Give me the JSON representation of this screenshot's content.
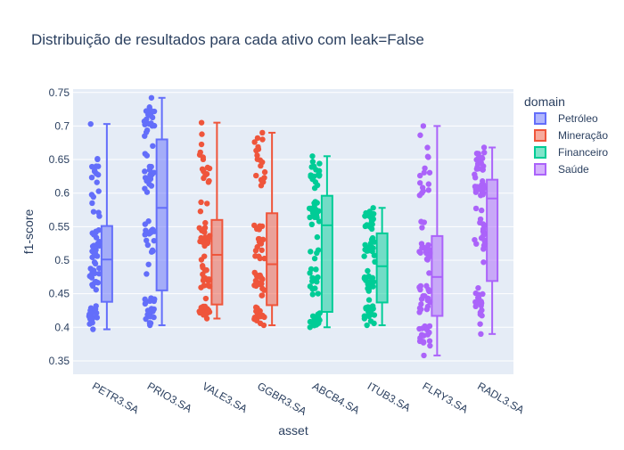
{
  "chart_data": {
    "type": "box",
    "title": "Distribuição de resultados para cada ativo com leak=False",
    "xlabel": "asset",
    "ylabel": "f1-score",
    "ylim": [
      0.33,
      0.755
    ],
    "yticks": [
      "0.35",
      "0.4",
      "0.45",
      "0.5",
      "0.55",
      "0.6",
      "0.65",
      "0.7",
      "0.75"
    ],
    "ytick_values": [
      0.35,
      0.4,
      0.45,
      0.5,
      0.55,
      0.6,
      0.65,
      0.7,
      0.75
    ],
    "categories": [
      "PETR3.SA",
      "PRIO3.SA",
      "VALE3.SA",
      "GGBR3.SA",
      "ABCB4.SA",
      "ITUB3.SA",
      "FLRY3.SA",
      "RADL3.SA"
    ],
    "legend_title": "domain",
    "legend_position": "top-right",
    "grid": true,
    "show_points": true,
    "series": [
      {
        "name": "Petróleo",
        "color": "#636efa",
        "boxes": [
          {
            "category": "PETR3.SA",
            "min": 0.397,
            "q1": 0.438,
            "median": 0.501,
            "q3": 0.551,
            "max": 0.703
          },
          {
            "category": "PRIO3.SA",
            "min": 0.403,
            "q1": 0.455,
            "median": 0.578,
            "q3": 0.68,
            "max": 0.742
          }
        ]
      },
      {
        "name": "Mineração",
        "color": "#ef553b",
        "boxes": [
          {
            "category": "VALE3.SA",
            "min": 0.413,
            "q1": 0.434,
            "median": 0.508,
            "q3": 0.56,
            "max": 0.705
          },
          {
            "category": "GGBR3.SA",
            "min": 0.403,
            "q1": 0.433,
            "median": 0.494,
            "q3": 0.57,
            "max": 0.69
          }
        ]
      },
      {
        "name": "Financeiro",
        "color": "#00cc96",
        "boxes": [
          {
            "category": "ABCB4.SA",
            "min": 0.4,
            "q1": 0.423,
            "median": 0.552,
            "q3": 0.596,
            "max": 0.655
          },
          {
            "category": "ITUB3.SA",
            "min": 0.403,
            "q1": 0.437,
            "median": 0.491,
            "q3": 0.54,
            "max": 0.578
          }
        ]
      },
      {
        "name": "Saúde",
        "color": "#ab63fa",
        "boxes": [
          {
            "category": "FLRY3.SA",
            "min": 0.358,
            "q1": 0.417,
            "median": 0.475,
            "q3": 0.536,
            "max": 0.7
          },
          {
            "category": "RADL3.SA",
            "min": 0.39,
            "q1": 0.469,
            "median": 0.592,
            "q3": 0.62,
            "max": 0.668
          }
        ]
      }
    ]
  }
}
